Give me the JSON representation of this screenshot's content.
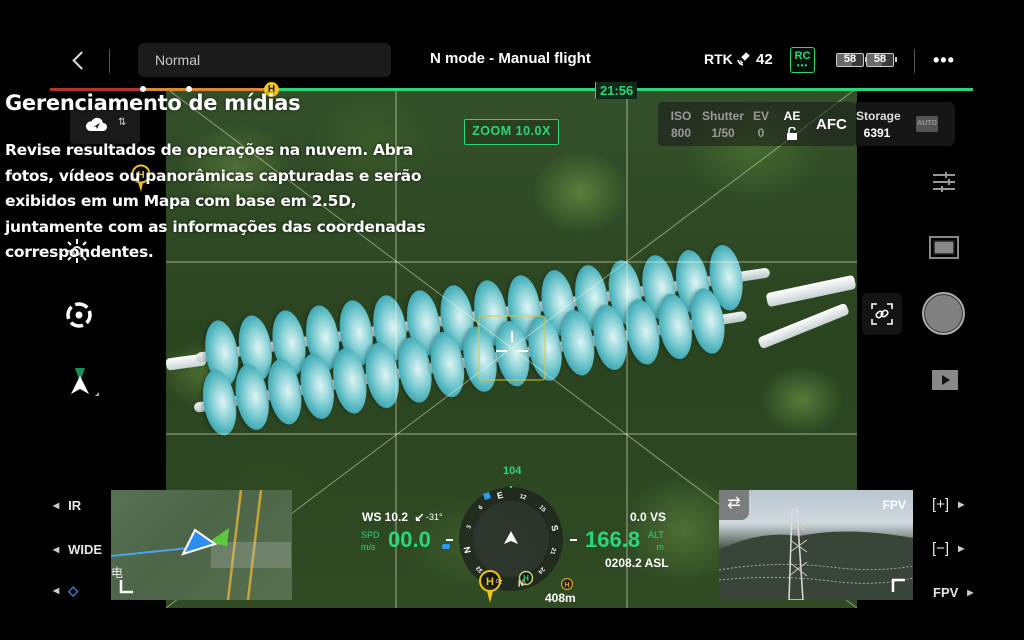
{
  "top_bar": {
    "back_label": "Back",
    "flight_mode_select": "Normal",
    "title": "N mode - Manual flight",
    "rtk_label": "RTK",
    "satellite_count": "42",
    "rc_label": "RC",
    "rc_dots": "•••",
    "battery_1": "58",
    "battery_2": "58",
    "more_label": "•••"
  },
  "timeline": {
    "home_marker": "H",
    "remaining_time": "21:56"
  },
  "overlay": {
    "title": "Gerenciamento de mídias",
    "body": "Revise resultados de operações na nuvem. Abra fotos, vídeos ou panorâmicas capturadas e serão exibidos em um Mapa com base em 2.5D, juntamente com as informações das coordenadas correspondentes."
  },
  "camera": {
    "zoom_label": "ZOOM  10.0X",
    "params": [
      {
        "label": "ISO",
        "value": "800"
      },
      {
        "label": "Shutter",
        "value": "1/50"
      },
      {
        "label": "EV",
        "value": "0"
      },
      {
        "label": "AE",
        "value": "🔓"
      }
    ],
    "focus_mode": "AFC",
    "storage_label": "Storage",
    "storage_value": "6391",
    "auto_badge": "AUTO"
  },
  "left_panel": {
    "cloud_sync_badge": "⇅",
    "home_marker": "H",
    "lens_controls": [
      {
        "label": "IR"
      },
      {
        "label": "WIDE"
      },
      {
        "label": "◇"
      }
    ]
  },
  "right_panel": {
    "zoom_controls": [
      {
        "label": "[+]"
      },
      {
        "label": "[−]"
      },
      {
        "label": "FPV"
      }
    ]
  },
  "hud": {
    "wind_speed": "WS 10.2",
    "wind_arrow": "↙",
    "wind_direction": "-31°",
    "speed_label_top": "SPD",
    "speed_label_bottom": "m/s",
    "speed_value": "00.0",
    "vertical_speed": "0.0 VS",
    "altitude_value": "166.8",
    "altitude_label_top": "ALT",
    "altitude_label_bottom": "m",
    "asl": "0208.2 ASL",
    "heading": "104",
    "compass_labels": [
      "E",
      "12",
      "15",
      "S",
      "21",
      "24",
      "W",
      "30",
      "33",
      "N",
      "3",
      "6"
    ],
    "home_distance": "408m",
    "home_label": "H"
  },
  "fpv": {
    "label": "FPV",
    "swap_label": "⇄"
  },
  "minimap": {
    "map_label": "电"
  }
}
